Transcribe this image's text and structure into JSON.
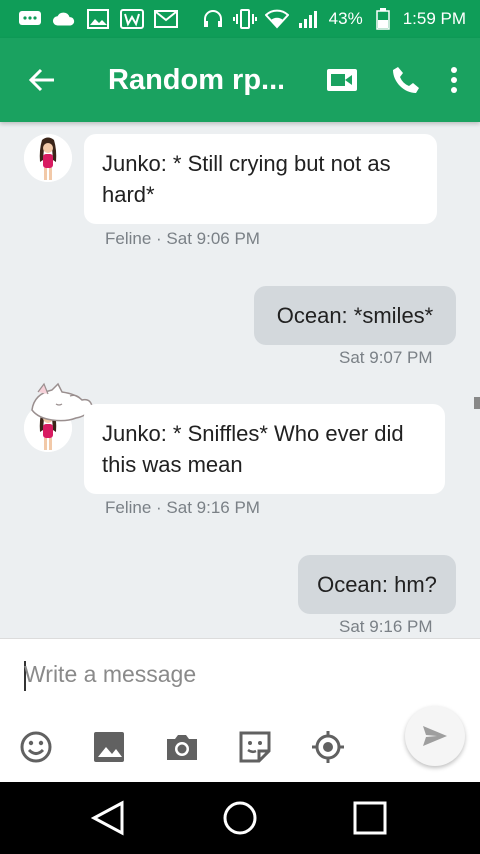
{
  "status_bar": {
    "battery": "43%",
    "time": "1:59 PM"
  },
  "app_bar": {
    "title": "Random rp..."
  },
  "messages": [
    {
      "direction": "incoming",
      "text": "Junko: * Still crying but not as hard*",
      "sender": "Feline",
      "time": "Sat 9:06 PM",
      "meta": "Feline · Sat 9:06 PM"
    },
    {
      "direction": "outgoing",
      "text": "Ocean: *smiles*",
      "time": "Sat 9:07 PM",
      "meta": "Sat 9:07 PM"
    },
    {
      "direction": "incoming",
      "text": "Junko: * Sniffles* Who ever did this was mean",
      "sender": "Feline",
      "time": "Sat 9:16 PM",
      "meta": "Feline · Sat 9:16 PM"
    },
    {
      "direction": "outgoing",
      "text": "Ocean: hm?",
      "time": "Sat 9:16 PM",
      "meta": "Sat 9:16 PM"
    }
  ],
  "composer": {
    "placeholder": "Write a message"
  },
  "colors": {
    "status_bar": "#0f9d58",
    "app_bar": "#1aa260",
    "incoming_bubble": "#ffffff",
    "outgoing_bubble": "#d3d8dc",
    "background": "#eceff1"
  }
}
